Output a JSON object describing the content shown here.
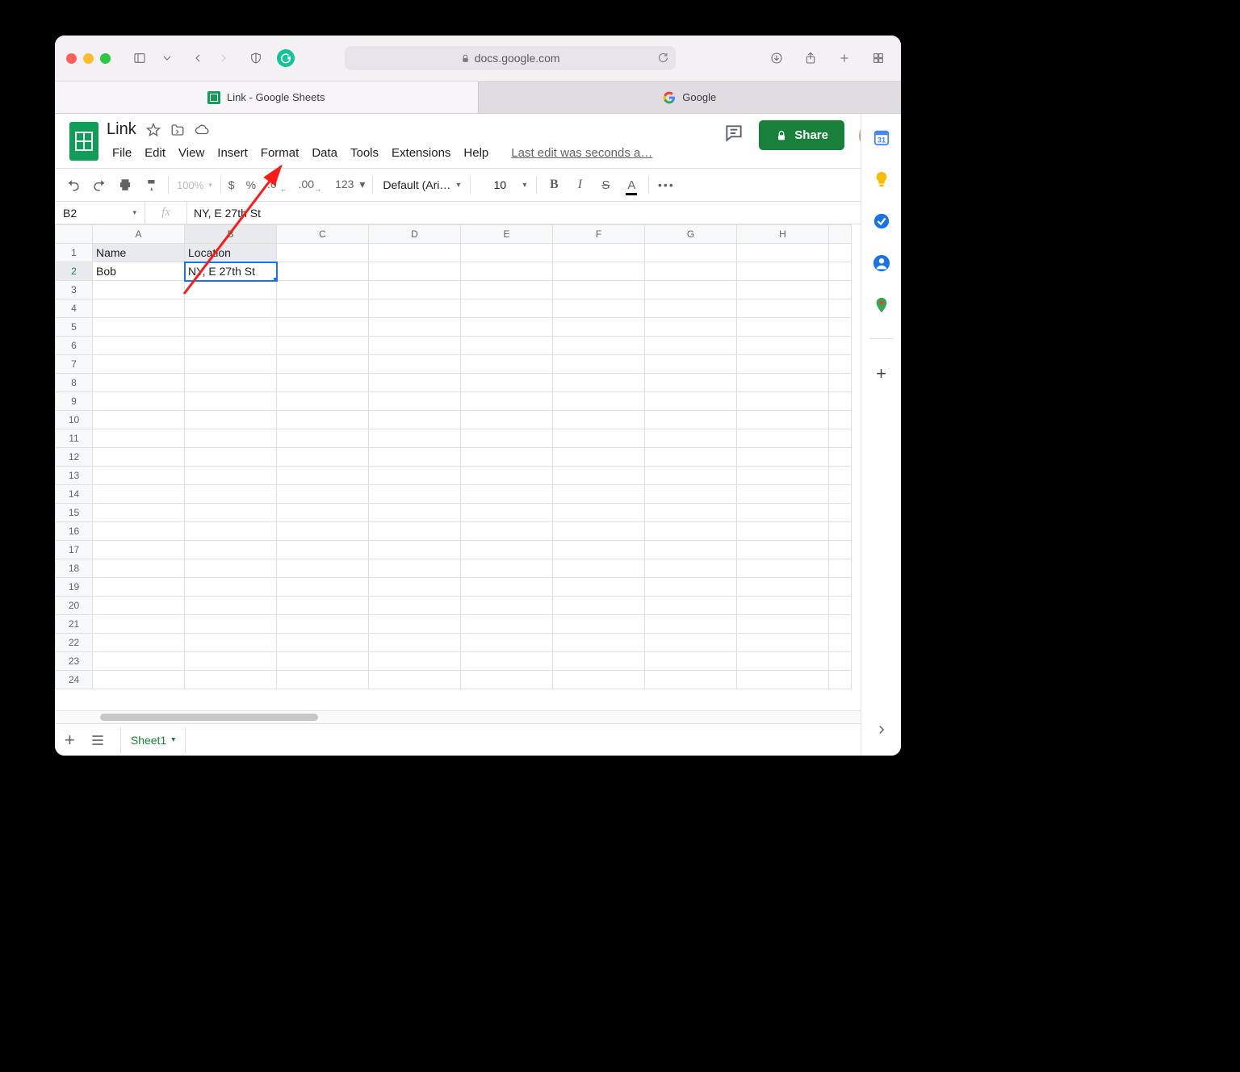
{
  "browser": {
    "address": "docs.google.com",
    "tabs": [
      {
        "label": "Link - Google Sheets",
        "active": true,
        "icon": "sheets"
      },
      {
        "label": "Google",
        "active": false,
        "icon": "google"
      }
    ]
  },
  "doc": {
    "title": "Link",
    "last_edit": "Last edit was seconds a…",
    "share_label": "Share"
  },
  "menus": [
    "File",
    "Edit",
    "View",
    "Insert",
    "Format",
    "Data",
    "Tools",
    "Extensions",
    "Help"
  ],
  "toolbar": {
    "zoom": "100%",
    "number_format": "123",
    "font": "Default (Ari…",
    "font_size": "10"
  },
  "namebox": "B2",
  "formula_value": "NY, E 27th St",
  "columns": [
    "A",
    "B",
    "C",
    "D",
    "E",
    "F",
    "G",
    "H"
  ],
  "row_count": 24,
  "selected_col_index": 1,
  "selected_row_index": 1,
  "cells": {
    "A1": "Name",
    "B1": "Location",
    "A2": "Bob",
    "B2": "NY, E 27th St"
  },
  "header_row": 0,
  "active_cell": "B2",
  "sheet_tab": "Sheet1",
  "sidepanel_icons": [
    "calendar",
    "keep",
    "tasks",
    "contacts",
    "maps"
  ]
}
